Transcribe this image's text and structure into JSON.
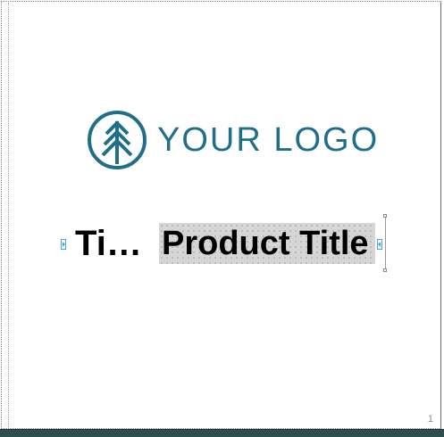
{
  "logo": {
    "text": "YOUR LOGO",
    "color": "#1f6f8b",
    "icon": "tree-in-circle-icon"
  },
  "title": {
    "short_text": "Ti…",
    "product_text": "Product Title"
  },
  "page": {
    "number": "1"
  },
  "colors": {
    "selection_handle": "#4aa3df",
    "highlight": "#d6d6d6",
    "bottom_bar": "#2f4f4f"
  }
}
